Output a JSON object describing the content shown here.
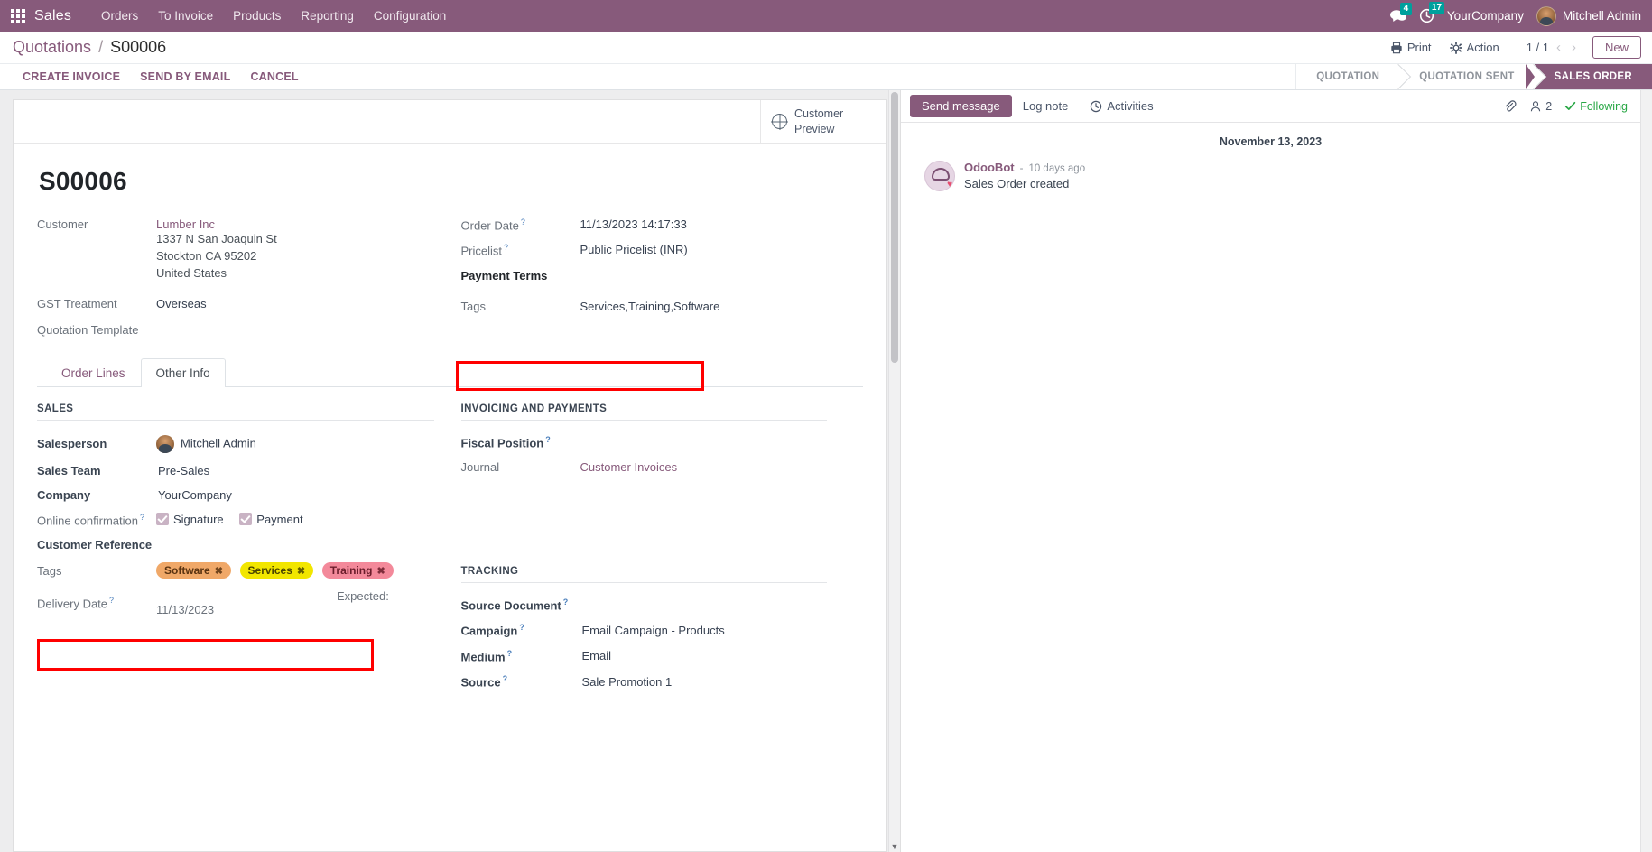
{
  "navbar": {
    "apps_icon": "apps-grid-icon",
    "app_name": "Sales",
    "menu_items": [
      "Orders",
      "To Invoice",
      "Products",
      "Reporting",
      "Configuration"
    ],
    "messages_count": "4",
    "activities_count": "17",
    "company": "YourCompany",
    "user": "Mitchell Admin",
    "brand_color": "#875A7B",
    "badge_color": "#00A09D"
  },
  "control_panel": {
    "breadcrumb_root": "Quotations",
    "breadcrumb_sep": "/",
    "breadcrumb_current": "S00006",
    "print_label": "Print",
    "action_label": "Action",
    "pager": "1 / 1",
    "prev_arrow": "‹",
    "next_arrow": "›",
    "new_label": "New"
  },
  "statusbar": {
    "buttons": [
      "CREATE INVOICE",
      "SEND BY EMAIL",
      "CANCEL"
    ],
    "stages": [
      {
        "label": "QUOTATION",
        "active": false
      },
      {
        "label": "QUOTATION SENT",
        "active": false
      },
      {
        "label": "SALES ORDER",
        "active": true
      }
    ]
  },
  "sheet": {
    "customer_preview_line1": "Customer",
    "customer_preview_line2": "Preview",
    "record_title": "S00006",
    "left_fields": [
      {
        "label": "Customer",
        "tip": false,
        "value_link": "Lumber Inc",
        "address": [
          "1337 N San Joaquin St",
          "Stockton CA 95202",
          "United States"
        ]
      },
      {
        "label": "GST Treatment",
        "tip": false,
        "value": "Overseas"
      },
      {
        "label": "Quotation Template",
        "tip": false,
        "value": ""
      }
    ],
    "right_fields": [
      {
        "label": "Order Date",
        "tip": true,
        "value": "11/13/2023 14:17:33"
      },
      {
        "label": "Pricelist",
        "tip": true,
        "value": "Public Pricelist (INR)"
      },
      {
        "label": "Payment Terms",
        "tip": false,
        "value": "",
        "bold": true
      },
      {
        "label": "Tags",
        "tip": false,
        "value": "Services,Training,Software",
        "highlight": true
      }
    ]
  },
  "notebook": {
    "tabs": [
      {
        "label": "Order Lines",
        "active": false
      },
      {
        "label": "Other Info",
        "active": true
      }
    ],
    "sales": {
      "title": "SALES",
      "salesperson_label": "Salesperson",
      "salesperson_value": "Mitchell Admin",
      "sales_team_label": "Sales Team",
      "sales_team_value": "Pre-Sales",
      "company_label": "Company",
      "company_value": "YourCompany",
      "online_confirmation_label": "Online confirmation",
      "signature_label": "Signature",
      "payment_label": "Payment",
      "signature_checked": true,
      "payment_checked": true,
      "customer_reference_label": "Customer Reference",
      "customer_reference_value": "",
      "tags_label": "Tags",
      "tags": [
        {
          "name": "Software",
          "bg": "#f0a868",
          "fg": "#5a3311"
        },
        {
          "name": "Services",
          "bg": "#f2e600",
          "fg": "#4a4400"
        },
        {
          "name": "Training",
          "bg": "#f3899a",
          "fg": "#6b1d2b"
        }
      ],
      "tag_remove_glyph": "✖",
      "delivery_date_label": "Delivery Date",
      "delivery_date_expected": "Expected: 11/13/2023"
    },
    "invoicing": {
      "title": "INVOICING AND PAYMENTS",
      "fiscal_position_label": "Fiscal Position",
      "fiscal_position_value": "",
      "journal_label": "Journal",
      "journal_value": "Customer Invoices"
    },
    "tracking": {
      "title": "TRACKING",
      "source_document_label": "Source Document",
      "source_document_value": "",
      "campaign_label": "Campaign",
      "campaign_value": "Email Campaign - Products",
      "medium_label": "Medium",
      "medium_value": "Email",
      "source_label": "Source",
      "source_value": "Sale Promotion 1"
    }
  },
  "chatter": {
    "send_message": "Send message",
    "log_note": "Log note",
    "activities": "Activities",
    "attachment_icon": "paperclip-icon",
    "followers_count": "2",
    "following_label": "Following",
    "thread_date": "November 13, 2023",
    "messages": [
      {
        "author": "OdooBot",
        "time": "10 days ago",
        "sep": "-",
        "body": "Sales Order created"
      }
    ]
  }
}
